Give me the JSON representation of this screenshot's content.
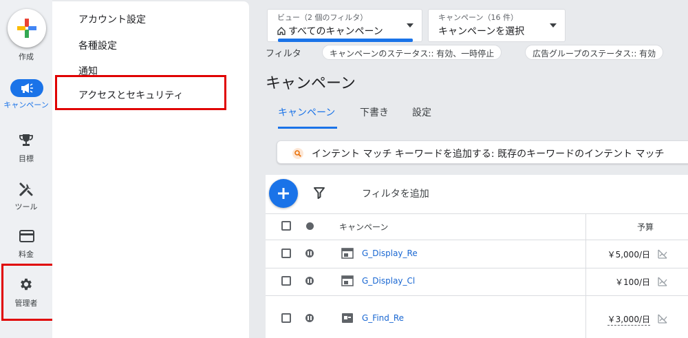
{
  "nav": {
    "create_label": "作成",
    "campaigns_label": "キャンペーン",
    "goals_label": "目標",
    "tools_label": "ツール",
    "billing_label": "料金",
    "admin_label": "管理者"
  },
  "admin_menu": {
    "items": [
      "アカウント設定",
      "各種設定",
      "通知",
      "アクセスとセキュリティ"
    ]
  },
  "view_dropdown": {
    "caption": "ビュー（2 個のフィルタ）",
    "value": "すべてのキャンペーン"
  },
  "campaign_dropdown": {
    "caption": "キャンペーン（16 件）",
    "value": "キャンペーンを選択"
  },
  "filters": {
    "label": "フィルタ",
    "chips": [
      "キャンペーンのステータス:: 有効、一時停止",
      "広告グループのステータス:: 有効"
    ]
  },
  "page_title": "キャンペーン",
  "tabs": [
    "キャンペーン",
    "下書き",
    "設定"
  ],
  "hint_text": "インテント マッチ キーワードを追加する: 既存のキーワードのインテント マッチ",
  "table": {
    "add_filter": "フィルタを追加",
    "col_campaign": "キャンペーン",
    "col_budget": "予算",
    "rows": [
      {
        "name": "G_Display_Re",
        "budget": "￥5,000/日"
      },
      {
        "name": "G_Display_Cl",
        "budget": "￥100/日"
      },
      {
        "name": "G_Find_Re",
        "budget": "￥3,000/日"
      }
    ]
  },
  "colors": {
    "accent": "#1a73e8",
    "highlight_box": "#e00000"
  }
}
